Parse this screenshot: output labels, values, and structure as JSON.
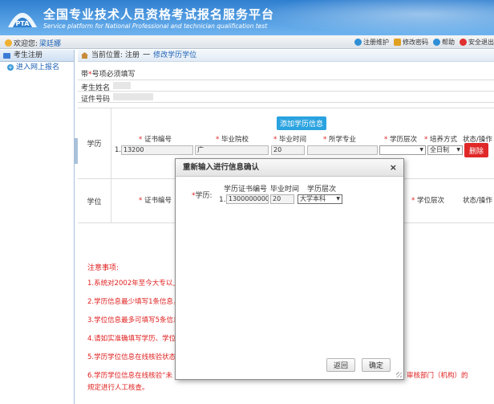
{
  "header": {
    "title": "全国专业技术人员资格考试报名服务平台",
    "subtitle": "Service platform for National Professional and technician qualification test",
    "logo_text": "PTA"
  },
  "userbar": {
    "welcome": "欢迎您:",
    "username": "梁廷娜",
    "links": [
      {
        "label": "注册维护",
        "icon": "user-edit-icon",
        "color": "#2f8fd6"
      },
      {
        "label": "修改密码",
        "icon": "lock-icon",
        "color": "#e0a020"
      },
      {
        "label": "帮助",
        "icon": "help-icon",
        "color": "#2f8fd6"
      },
      {
        "label": "安全退出",
        "icon": "power-icon",
        "color": "#e03030"
      }
    ]
  },
  "sidebar": {
    "header": "考生注册",
    "items": [
      {
        "label": "进入网上报名"
      }
    ]
  },
  "breadcrumb": {
    "prefix": "当前位置:",
    "root": "注册",
    "separator": "一",
    "current": "修改学历学位"
  },
  "form": {
    "required_note_prefix": "带",
    "required_star": "*",
    "required_note_suffix": "号项必须填写",
    "name_label": "考生姓名",
    "id_label": "证件号码",
    "education": {
      "label": "学历",
      "add_button": "添加学历信息",
      "columns": {
        "cert_no": "证书编号",
        "school": "毕业院校",
        "grad_time": "毕业时间",
        "major": "所学专业",
        "level": "学历层次",
        "mode": "培养方式",
        "status": "状态/操作"
      },
      "row": {
        "index": "1.",
        "cert_no": "13200",
        "school": "广",
        "grad_time": "20",
        "level": "",
        "mode": "全日制",
        "delete": "删除"
      }
    },
    "degree": {
      "label": "学位",
      "columns": {
        "cert_no": "证书编号",
        "level": "学位层次",
        "status": "状态/操作"
      }
    }
  },
  "notes": {
    "title": "注意事项:",
    "lines": [
      "1.系统对2002年至今大专以上",
      "2.学历信息最少填写1条信息，",
      "3.学位信息最多可填写5条信息",
      "4.请如实准确填写学历、学位",
      "5.学历学位信息在线核验状态",
      "6.学历学位信息在线核验“未"
    ],
    "line6_tail": "审核部门（机构）的",
    "line7": "规定进行人工核查。"
  },
  "modal": {
    "title": "重新输入进行信息确认",
    "close": "×",
    "field_label": "学历:",
    "col_cert_no": "学历证书编号",
    "col_grad_time": "毕业时间",
    "col_level": "学历层次",
    "row_index": "1.",
    "cert_no_value": "1300000000",
    "grad_time_value": "20",
    "level_value": "大学本科",
    "back_button": "返回",
    "confirm_button": "确定"
  }
}
